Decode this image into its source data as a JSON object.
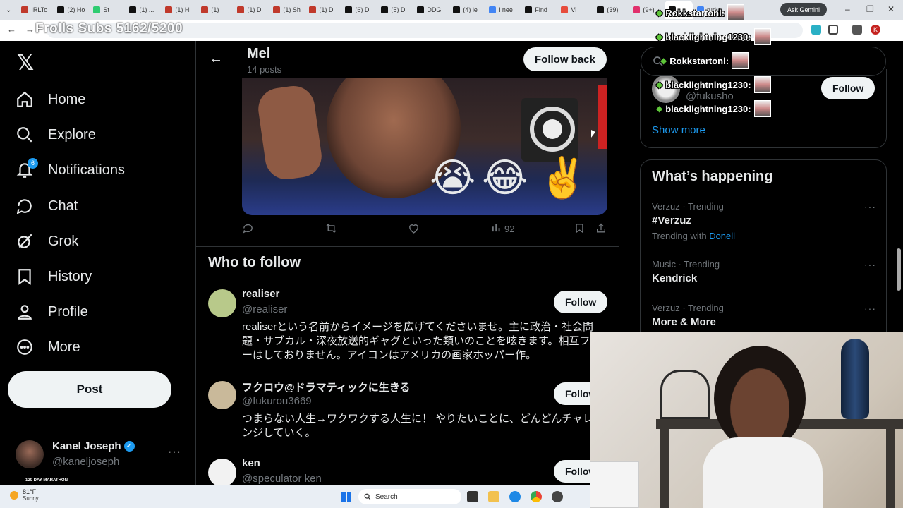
{
  "browser": {
    "tabs": [
      {
        "label": "IRLTo",
        "color": "#c0392b"
      },
      {
        "label": "(2) Ho",
        "color": "#111111"
      },
      {
        "label": "St",
        "color": "#2ecc71"
      },
      {
        "label": "(1) ...",
        "color": "#111111"
      },
      {
        "label": "(1) Hi",
        "color": "#c0392b"
      },
      {
        "label": "(1)",
        "color": "#c0392b"
      },
      {
        "label": "(1) D",
        "color": "#c0392b"
      },
      {
        "label": "(1) Sh",
        "color": "#c0392b"
      },
      {
        "label": "(1) D",
        "color": "#c0392b"
      },
      {
        "label": "(6) D",
        "color": "#111111"
      },
      {
        "label": "(5) D",
        "color": "#111111"
      },
      {
        "label": "DDG",
        "color": "#111111"
      },
      {
        "label": "(4) le",
        "color": "#111111"
      },
      {
        "label": "i nee",
        "color": "#4285f4"
      },
      {
        "label": "Find",
        "color": "#111111"
      },
      {
        "label": "Vi",
        "color": "#e74c3c"
      },
      {
        "label": "(39)",
        "color": "#111111"
      },
      {
        "label": "(9+)",
        "color": "#e1306c"
      },
      {
        "label": "",
        "color": "#111111"
      },
      {
        "label": "turke",
        "color": "#4285f4"
      }
    ],
    "gemini_label": "Ask Gemini",
    "profile_initial": "K"
  },
  "overlay": {
    "subs_text": "Frolls Subs 5162/5200",
    "chat": [
      {
        "name": "Rokkstartonl:"
      },
      {
        "name": "blacklightning1230:"
      },
      {
        "name": "Rokkstartonl:"
      },
      {
        "name": "blacklightning1230:"
      },
      {
        "name": "blacklightning1230:"
      }
    ]
  },
  "nav": {
    "items": [
      {
        "label": "Home",
        "icon": "home-icon"
      },
      {
        "label": "Explore",
        "icon": "search-icon"
      },
      {
        "label": "Notifications",
        "icon": "bell-icon",
        "badge": "6"
      },
      {
        "label": "Chat",
        "icon": "chat-icon"
      },
      {
        "label": "Grok",
        "icon": "grok-icon"
      },
      {
        "label": "History",
        "icon": "bookmark-icon"
      },
      {
        "label": "Profile",
        "icon": "person-icon"
      },
      {
        "label": "More",
        "icon": "more-circle-icon"
      }
    ],
    "post_label": "Post",
    "account": {
      "name": "Kanel Joseph",
      "handle": "@kaneljoseph",
      "avatar_caption": "120 DAY MARATHON"
    }
  },
  "profile_header": {
    "name": "Mel",
    "posts": "14 posts",
    "follow_back": "Follow back"
  },
  "tweet": {
    "views": "92"
  },
  "who_to_follow": {
    "title": "Who to follow",
    "users": [
      {
        "name": "realiser",
        "handle": "@realiser",
        "bio": "realiserという名前からイメージを広げてくださいませ。主に政治・社会問題・サブカル・深夜放送的ギャグといった類いのことを呟きます。相互フローはしておりません。アイコンはアメリカの画家ホッパー作。",
        "follow": "Follow",
        "avatar_color": "#b8c98a"
      },
      {
        "name": "フクロウ@ドラマティックに生きる",
        "handle": "@fukurou3669",
        "bio": "つまらない人生→ワクワクする人生に！ やりたいことに、どんどんチャレンジしていく。",
        "follow": "Follow",
        "avatar_color": "#c9b99a"
      },
      {
        "name": "ken",
        "handle": "@speculator ken",
        "bio": "",
        "follow": "Follow",
        "avatar_color": "#f2f2f2"
      }
    ]
  },
  "sidebar": {
    "search_placeholder": "Search",
    "people_suggestion": {
      "handle": "@fukusho",
      "follow": "Follow"
    },
    "show_more": "Show more",
    "whats_happening": "What’s happening",
    "trends": [
      {
        "meta": "Verzuz · Trending",
        "name": "#Verzuz",
        "with_label": "Trending with",
        "with_link": "Donell"
      },
      {
        "meta": "Music · Trending",
        "name": "Kendrick"
      },
      {
        "meta": "Verzuz · Trending",
        "name": "More & More"
      }
    ]
  },
  "taskbar": {
    "temp": "81°F",
    "condition": "Sunny",
    "search_label": "Search"
  }
}
